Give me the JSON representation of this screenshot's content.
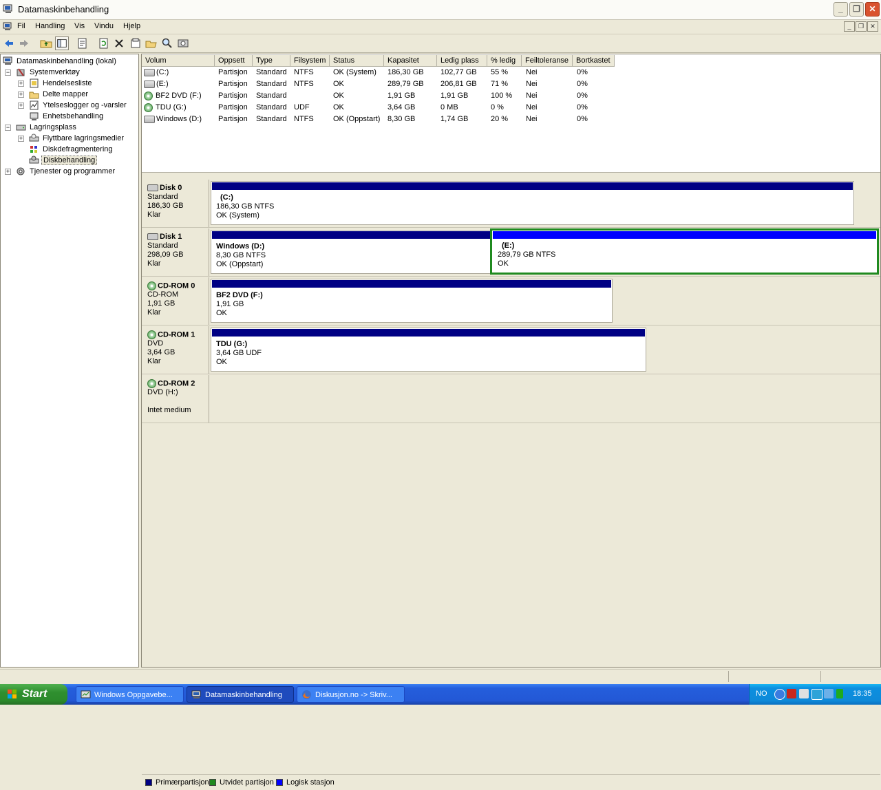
{
  "window": {
    "title": "Datamaskinbehandling"
  },
  "menu": [
    "Fil",
    "Handling",
    "Vis",
    "Vindu",
    "Hjelp"
  ],
  "tree": {
    "root": "Datamaskinbehandling (lokal)",
    "systemverktoy": "Systemverktøy",
    "hendelsesliste": "Hendelsesliste",
    "delte_mapper": "Delte mapper",
    "ytelseslogger": "Ytelseslogger og -varsler",
    "enhetsbehandling": "Enhetsbehandling",
    "lagringsplass": "Lagringsplass",
    "flyttbare": "Flyttbare lagringsmedier",
    "diskdefrag": "Diskdefragmentering",
    "diskbehandling": "Diskbehandling",
    "tjenester": "Tjenester og programmer"
  },
  "volume_list": {
    "columns": [
      "Volum",
      "Oppsett",
      "Type",
      "Filsystem",
      "Status",
      "Kapasitet",
      "Ledig plass",
      "% ledig",
      "Feiltoleranse",
      "Bortkastet"
    ],
    "rows": [
      [
        "(C:)",
        "Partisjon",
        "Standard",
        "NTFS",
        "OK (System)",
        "186,30 GB",
        "102,77 GB",
        "55 %",
        "Nei",
        "0%"
      ],
      [
        "(E:)",
        "Partisjon",
        "Standard",
        "NTFS",
        "OK",
        "289,79 GB",
        "206,81 GB",
        "71 %",
        "Nei",
        "0%"
      ],
      [
        "BF2 DVD (F:)",
        "Partisjon",
        "Standard",
        "",
        "OK",
        "1,91 GB",
        "1,91 GB",
        "100 %",
        "Nei",
        "0%"
      ],
      [
        "TDU (G:)",
        "Partisjon",
        "Standard",
        "UDF",
        "OK",
        "3,64 GB",
        "0 MB",
        "0 %",
        "Nei",
        "0%"
      ],
      [
        "Windows (D:)",
        "Partisjon",
        "Standard",
        "NTFS",
        "OK (Oppstart)",
        "8,30 GB",
        "1,74 GB",
        "20 %",
        "Nei",
        "0%"
      ]
    ]
  },
  "disks": [
    {
      "name": "Disk 0",
      "line1": "Standard",
      "line2": "186,30 GB",
      "line3": "Klar",
      "partitions": [
        {
          "label": "(C:)",
          "size": "186,30 GB NTFS",
          "status": "OK (System)"
        }
      ]
    },
    {
      "name": "Disk 1",
      "line1": "Standard",
      "line2": "298,09 GB",
      "line3": "Klar",
      "partitions": [
        {
          "label": "Windows  (D:)",
          "size": "8,30 GB NTFS",
          "status": "OK (Oppstart)"
        },
        {
          "label": "(E:)",
          "size": "289,79 GB NTFS",
          "status": "OK"
        }
      ]
    },
    {
      "name": "CD-ROM 0",
      "line1": "CD-ROM",
      "line2": "1,91 GB",
      "line3": "Klar",
      "partitions": [
        {
          "label": "BF2 DVD  (F:)",
          "size": "1,91 GB",
          "status": "OK"
        }
      ]
    },
    {
      "name": "CD-ROM 1",
      "line1": "DVD",
      "line2": "3,64 GB",
      "line3": "Klar",
      "partitions": [
        {
          "label": "TDU  (G:)",
          "size": "3,64 GB UDF",
          "status": "OK"
        }
      ]
    },
    {
      "name": "CD-ROM 2",
      "line1": "DVD (H:)",
      "line2": "",
      "line3": "Intet medium",
      "partitions": []
    }
  ],
  "legend": {
    "primary": "Primærpartisjon",
    "extended": "Utvidet partisjon",
    "logical": "Logisk stasjon",
    "colors": {
      "primary": "#000084",
      "extended": "#1f8a1f",
      "logical": "#0000ff"
    }
  },
  "taskbar": {
    "start": "Start",
    "tasks": [
      "Windows Oppgavebe...",
      "Datamaskinbehandling",
      "Diskusjon.no -> Skriv..."
    ],
    "lang": "NO",
    "clock": "18:35"
  }
}
